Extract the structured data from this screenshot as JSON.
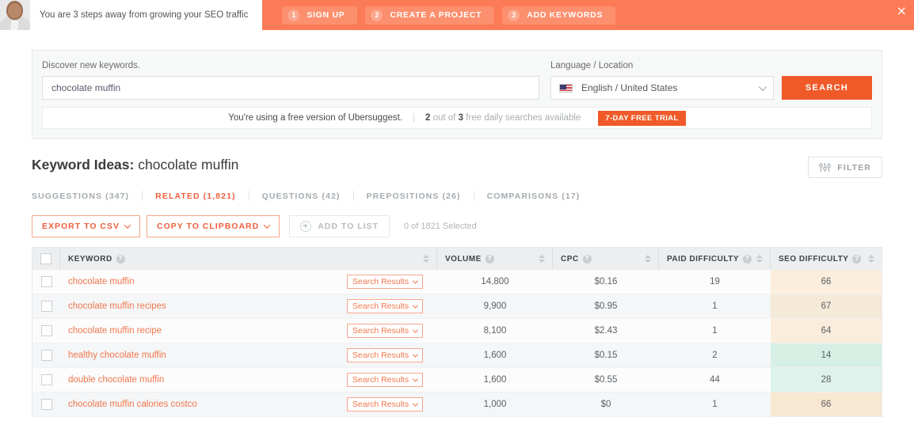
{
  "promo": {
    "message": "You are 3 steps away from growing your SEO traffic",
    "close_label": "×",
    "steps": [
      {
        "num": "1",
        "label": "SIGN UP"
      },
      {
        "num": "2",
        "label": "CREATE A PROJECT"
      },
      {
        "num": "3",
        "label": "ADD KEYWORDS"
      }
    ]
  },
  "search": {
    "keyword_label": "Discover new keywords.",
    "keyword_value": "chocolate muffin",
    "keyword_placeholder": "Discover new keywords.",
    "language_label": "Language / Location",
    "language_value": "English / United States",
    "search_button": "SEARCH"
  },
  "notice": {
    "text_free": "You're using a free version of Ubersuggest.",
    "used": "2",
    "mid": " out of ",
    "total": "3",
    "tail": " free daily searches available",
    "trial_button": "7-DAY FREE TRIAL"
  },
  "results": {
    "title_prefix": "Keyword Ideas:",
    "title_keyword": "chocolate muffin",
    "filter_button": "FILTER",
    "tabs": [
      {
        "label": "SUGGESTIONS (347)",
        "active": false
      },
      {
        "label": "RELATED (1,821)",
        "active": true
      },
      {
        "label": "QUESTIONS (42)",
        "active": false
      },
      {
        "label": "PREPOSITIONS (26)",
        "active": false
      },
      {
        "label": "COMPARISONS (17)",
        "active": false
      }
    ],
    "actions": {
      "export_csv": "EXPORT TO CSV",
      "copy_clipboard": "COPY TO CLIPBOARD",
      "add_to_list": "ADD TO LIST",
      "plus": "+",
      "selected_count": "0 of 1821 Selected"
    }
  },
  "table": {
    "columns": [
      {
        "label": "KEYWORD",
        "help": "?"
      },
      {
        "label": "VOLUME",
        "help": "?"
      },
      {
        "label": "CPC",
        "help": "?"
      },
      {
        "label": "PAID DIFFICULTY",
        "help": "?"
      },
      {
        "label": "SEO DIFFICULTY",
        "help": "?"
      }
    ],
    "search_results_label": "Search Results",
    "rows": [
      {
        "keyword": "chocolate muffin",
        "volume": "14,800",
        "cpc": "$0.16",
        "paid": "19",
        "seo": "66",
        "seo_color": "#fbeedc"
      },
      {
        "keyword": "chocolate muffin recipes",
        "volume": "9,900",
        "cpc": "$0.95",
        "paid": "1",
        "seo": "67",
        "seo_color": "#f5ead8"
      },
      {
        "keyword": "chocolate muffin recipe",
        "volume": "8,100",
        "cpc": "$2.43",
        "paid": "1",
        "seo": "64",
        "seo_color": "#fbeddc"
      },
      {
        "keyword": "healthy chocolate muffin",
        "volume": "1,600",
        "cpc": "$0.15",
        "paid": "2",
        "seo": "14",
        "seo_color": "#d6f0e6"
      },
      {
        "keyword": "double chocolate muffin",
        "volume": "1,600",
        "cpc": "$0.55",
        "paid": "44",
        "seo": "28",
        "seo_color": "#ddf3eb"
      },
      {
        "keyword": "chocolate muffin calories costco",
        "volume": "1,000",
        "cpc": "$0",
        "paid": "1",
        "seo": "66",
        "seo_color": "#f8e7d1"
      }
    ]
  },
  "colors": {
    "brand_orange": "#f05a28",
    "promo_orange": "#fb7b56",
    "link_orange": "#f0774e"
  }
}
